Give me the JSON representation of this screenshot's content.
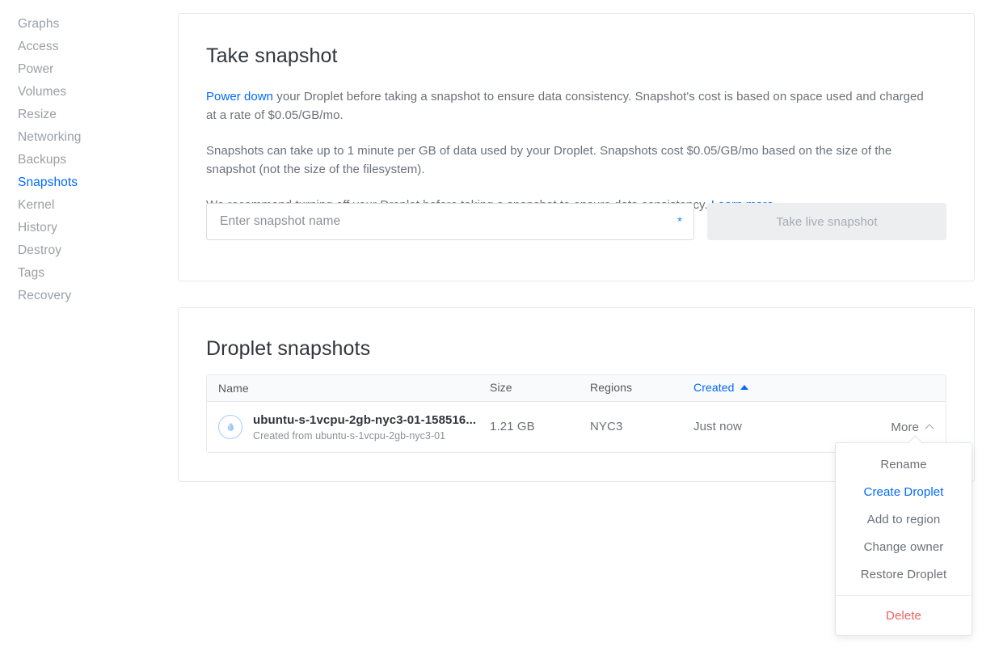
{
  "sidebar": {
    "items": [
      {
        "label": "Graphs",
        "active": false
      },
      {
        "label": "Access",
        "active": false
      },
      {
        "label": "Power",
        "active": false
      },
      {
        "label": "Volumes",
        "active": false
      },
      {
        "label": "Resize",
        "active": false
      },
      {
        "label": "Networking",
        "active": false
      },
      {
        "label": "Backups",
        "active": false
      },
      {
        "label": "Snapshots",
        "active": true
      },
      {
        "label": "Kernel",
        "active": false
      },
      {
        "label": "History",
        "active": false
      },
      {
        "label": "Destroy",
        "active": false
      },
      {
        "label": "Tags",
        "active": false
      },
      {
        "label": "Recovery",
        "active": false
      }
    ]
  },
  "take_snapshot": {
    "title": "Take snapshot",
    "paragraph1_link": "Power down",
    "paragraph1_rest": " your Droplet before taking a snapshot to ensure data consistency. Snapshot's cost is based on space used and charged at a rate of $0.05/GB/mo.",
    "paragraph2": "Snapshots can take up to 1 minute per GB of data used by your Droplet. Snapshots cost $0.05/GB/mo based on the size of the snapshot (not the size of the filesystem).",
    "paragraph3_text": "We recommend turning off your Droplet before taking a snapshot to ensure data consistency. ",
    "paragraph3_link": "Learn more",
    "paragraph3_period": ".",
    "input_placeholder": "Enter snapshot name",
    "input_value": "",
    "required_marker": "*",
    "button_label": "Take live snapshot",
    "button_disabled": true
  },
  "droplet_snapshots": {
    "title": "Droplet snapshots",
    "columns": [
      "Name",
      "Size",
      "Regions",
      "Created"
    ],
    "sorted_column": "Created",
    "sort_direction": "asc",
    "rows": [
      {
        "icon": "droplet-icon",
        "name": "ubuntu-s-1vcpu-2gb-nyc3-01-158516...",
        "subtitle": "Created from ubuntu-s-1vcpu-2gb-nyc3-01",
        "size": "1.21 GB",
        "region": "NYC3",
        "created": "Just now",
        "more_label": "More"
      }
    ]
  },
  "more_menu": {
    "open": true,
    "items": [
      {
        "label": "Rename",
        "style": "normal"
      },
      {
        "label": "Create Droplet",
        "style": "accent"
      },
      {
        "label": "Add to region",
        "style": "normal"
      },
      {
        "label": "Change owner",
        "style": "normal"
      },
      {
        "label": "Restore Droplet",
        "style": "normal"
      }
    ],
    "danger_item": {
      "label": "Delete",
      "style": "danger"
    }
  },
  "colors": {
    "accent": "#0069ff",
    "danger": "#f06060",
    "muted": "#9aa0a6",
    "text": "#31363c",
    "body_text": "#6b7177",
    "border": "#e5e8ed",
    "header_bg": "#f9fafb",
    "disabled_bg": "#eceef0"
  }
}
